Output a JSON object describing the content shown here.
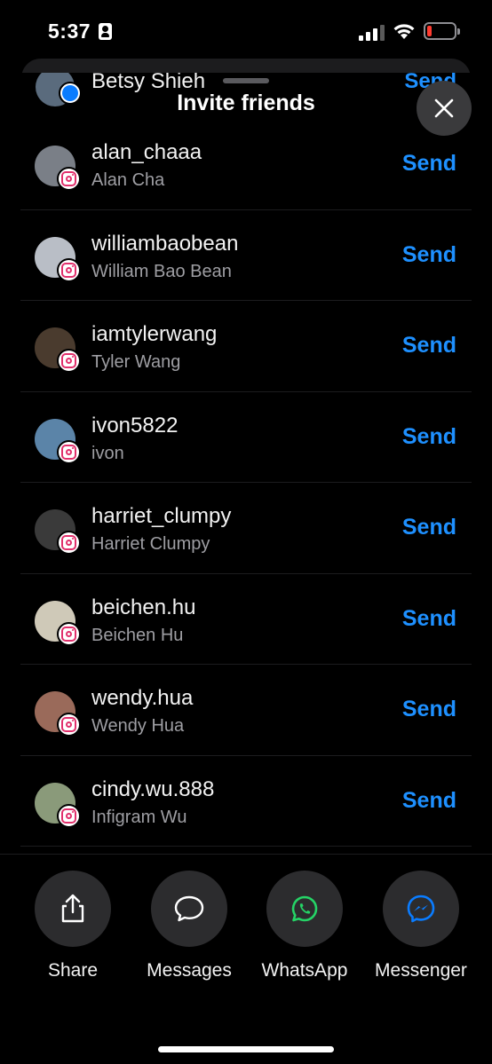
{
  "status_bar": {
    "time": "5:37"
  },
  "sheet": {
    "title": "Invite friends",
    "peek_contact": {
      "name": "Betsy Shieh",
      "send_label": "Send",
      "source": "messenger"
    }
  },
  "contacts": [
    {
      "username": "alan_chaaa",
      "full_name": "Alan Cha",
      "send_label": "Send",
      "source": "instagram",
      "avatar_color": "#7a7f87"
    },
    {
      "username": "williambaobean",
      "full_name": "William Bao Bean",
      "send_label": "Send",
      "source": "instagram",
      "avatar_color": "#b9bec6"
    },
    {
      "username": "iamtylerwang",
      "full_name": "Tyler Wang",
      "send_label": "Send",
      "source": "instagram",
      "avatar_color": "#4a3b2e"
    },
    {
      "username": "ivon5822",
      "full_name": "ivon",
      "send_label": "Send",
      "source": "instagram",
      "avatar_color": "#5b84a8"
    },
    {
      "username": "harriet_clumpy",
      "full_name": "Harriet Clumpy",
      "send_label": "Send",
      "source": "instagram",
      "avatar_color": "#3a3a3a"
    },
    {
      "username": "beichen.hu",
      "full_name": "Beichen Hu",
      "send_label": "Send",
      "source": "instagram",
      "avatar_color": "#cfc9b8"
    },
    {
      "username": "wendy.hua",
      "full_name": "Wendy Hua",
      "send_label": "Send",
      "source": "instagram",
      "avatar_color": "#9a6a5a"
    },
    {
      "username": "cindy.wu.888",
      "full_name": "Infigram Wu",
      "send_label": "Send",
      "source": "instagram",
      "avatar_color": "#8a9a7a"
    }
  ],
  "share_options": [
    {
      "label": "Share",
      "icon": "share-icon"
    },
    {
      "label": "Messages",
      "icon": "messages-icon"
    },
    {
      "label": "WhatsApp",
      "icon": "whatsapp-icon"
    },
    {
      "label": "Messenger",
      "icon": "messenger-icon"
    }
  ],
  "colors": {
    "accent": "#1e90ff",
    "background": "#000000",
    "secondary_text": "#9e9ea3",
    "share_circle": "#2c2c2e",
    "instagram_badge": "#e1306c",
    "messenger_blue": "#0a7cff",
    "whatsapp_green": "#25d366",
    "battery_low": "#ff3b30"
  }
}
